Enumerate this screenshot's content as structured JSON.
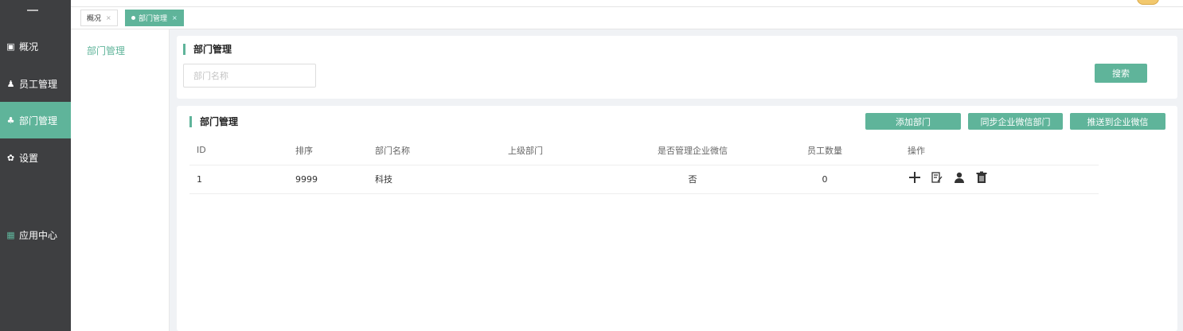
{
  "sidebar": {
    "items": [
      {
        "label": "概况",
        "icon": "chart-icon"
      },
      {
        "label": "员工管理",
        "icon": "user-gear-icon"
      },
      {
        "label": "部门管理",
        "icon": "org-tree-icon",
        "active": true
      },
      {
        "label": "设置",
        "icon": "gear-icon"
      },
      {
        "label": "应用中心",
        "icon": "apps-grid-icon"
      }
    ]
  },
  "tabs": [
    {
      "label": "概况",
      "close": "×"
    },
    {
      "label": "部门管理",
      "close": "×",
      "active": true
    }
  ],
  "subnav": {
    "item": "部门管理"
  },
  "search_card": {
    "title": "部门管理",
    "input_placeholder": "部门名称",
    "search_button": "搜索"
  },
  "list_card": {
    "title": "部门管理",
    "buttons": {
      "add": "添加部门",
      "sync": "同步企业微信部门",
      "push": "推送到企业微信"
    },
    "columns": [
      "ID",
      "排序",
      "部门名称",
      "上级部门",
      "是否管理企业微信",
      "员工数量",
      "操作"
    ],
    "rows": [
      {
        "id": "1",
        "sort": "9999",
        "name": "科技",
        "parent": "",
        "manage_wechat": "否",
        "staff_count": "0"
      }
    ],
    "row_actions": [
      "add-icon",
      "edit-icon",
      "user-icon",
      "delete-icon"
    ]
  },
  "colors": {
    "accent": "#5fb49a",
    "sidebar_bg": "#3e3f41"
  }
}
